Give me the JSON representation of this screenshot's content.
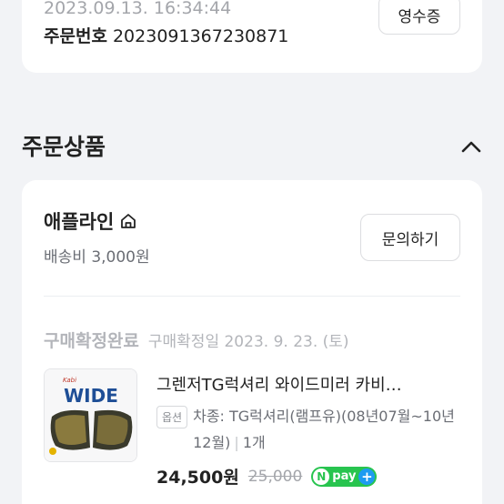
{
  "order": {
    "date": "2023.09.13. 16:34:44",
    "number_label": "주문번호",
    "number": "2023091367230871",
    "receipt_button": "영수증"
  },
  "section": {
    "title": "주문상품"
  },
  "seller": {
    "name": "애플라인",
    "shipping": "배송비 3,000원",
    "inquiry_button": "문의하기"
  },
  "item": {
    "status": "구매확정완료",
    "confirm_date": "구매확정일 2023. 9. 23. (토)",
    "title": "그렌저TG럭셔리 와이드미러 카비…",
    "option_badge": "옵션",
    "option_text": "차종: TG럭셔리(램프유)(08년07월~10년12월)",
    "quantity": "1개",
    "price": "24,500원",
    "original_price": "25,000",
    "npay_label": "pay",
    "thumb_brand": "Kabi",
    "thumb_title": "WIDE"
  },
  "icons": {
    "store": "store-icon",
    "collapse": "chevron-up-icon",
    "npay": "npay-plus-icon"
  },
  "colors": {
    "background": "#f2f3f6",
    "card": "#ffffff",
    "npay_green": "#28c44f",
    "npay_blue": "#1e9bf0"
  }
}
